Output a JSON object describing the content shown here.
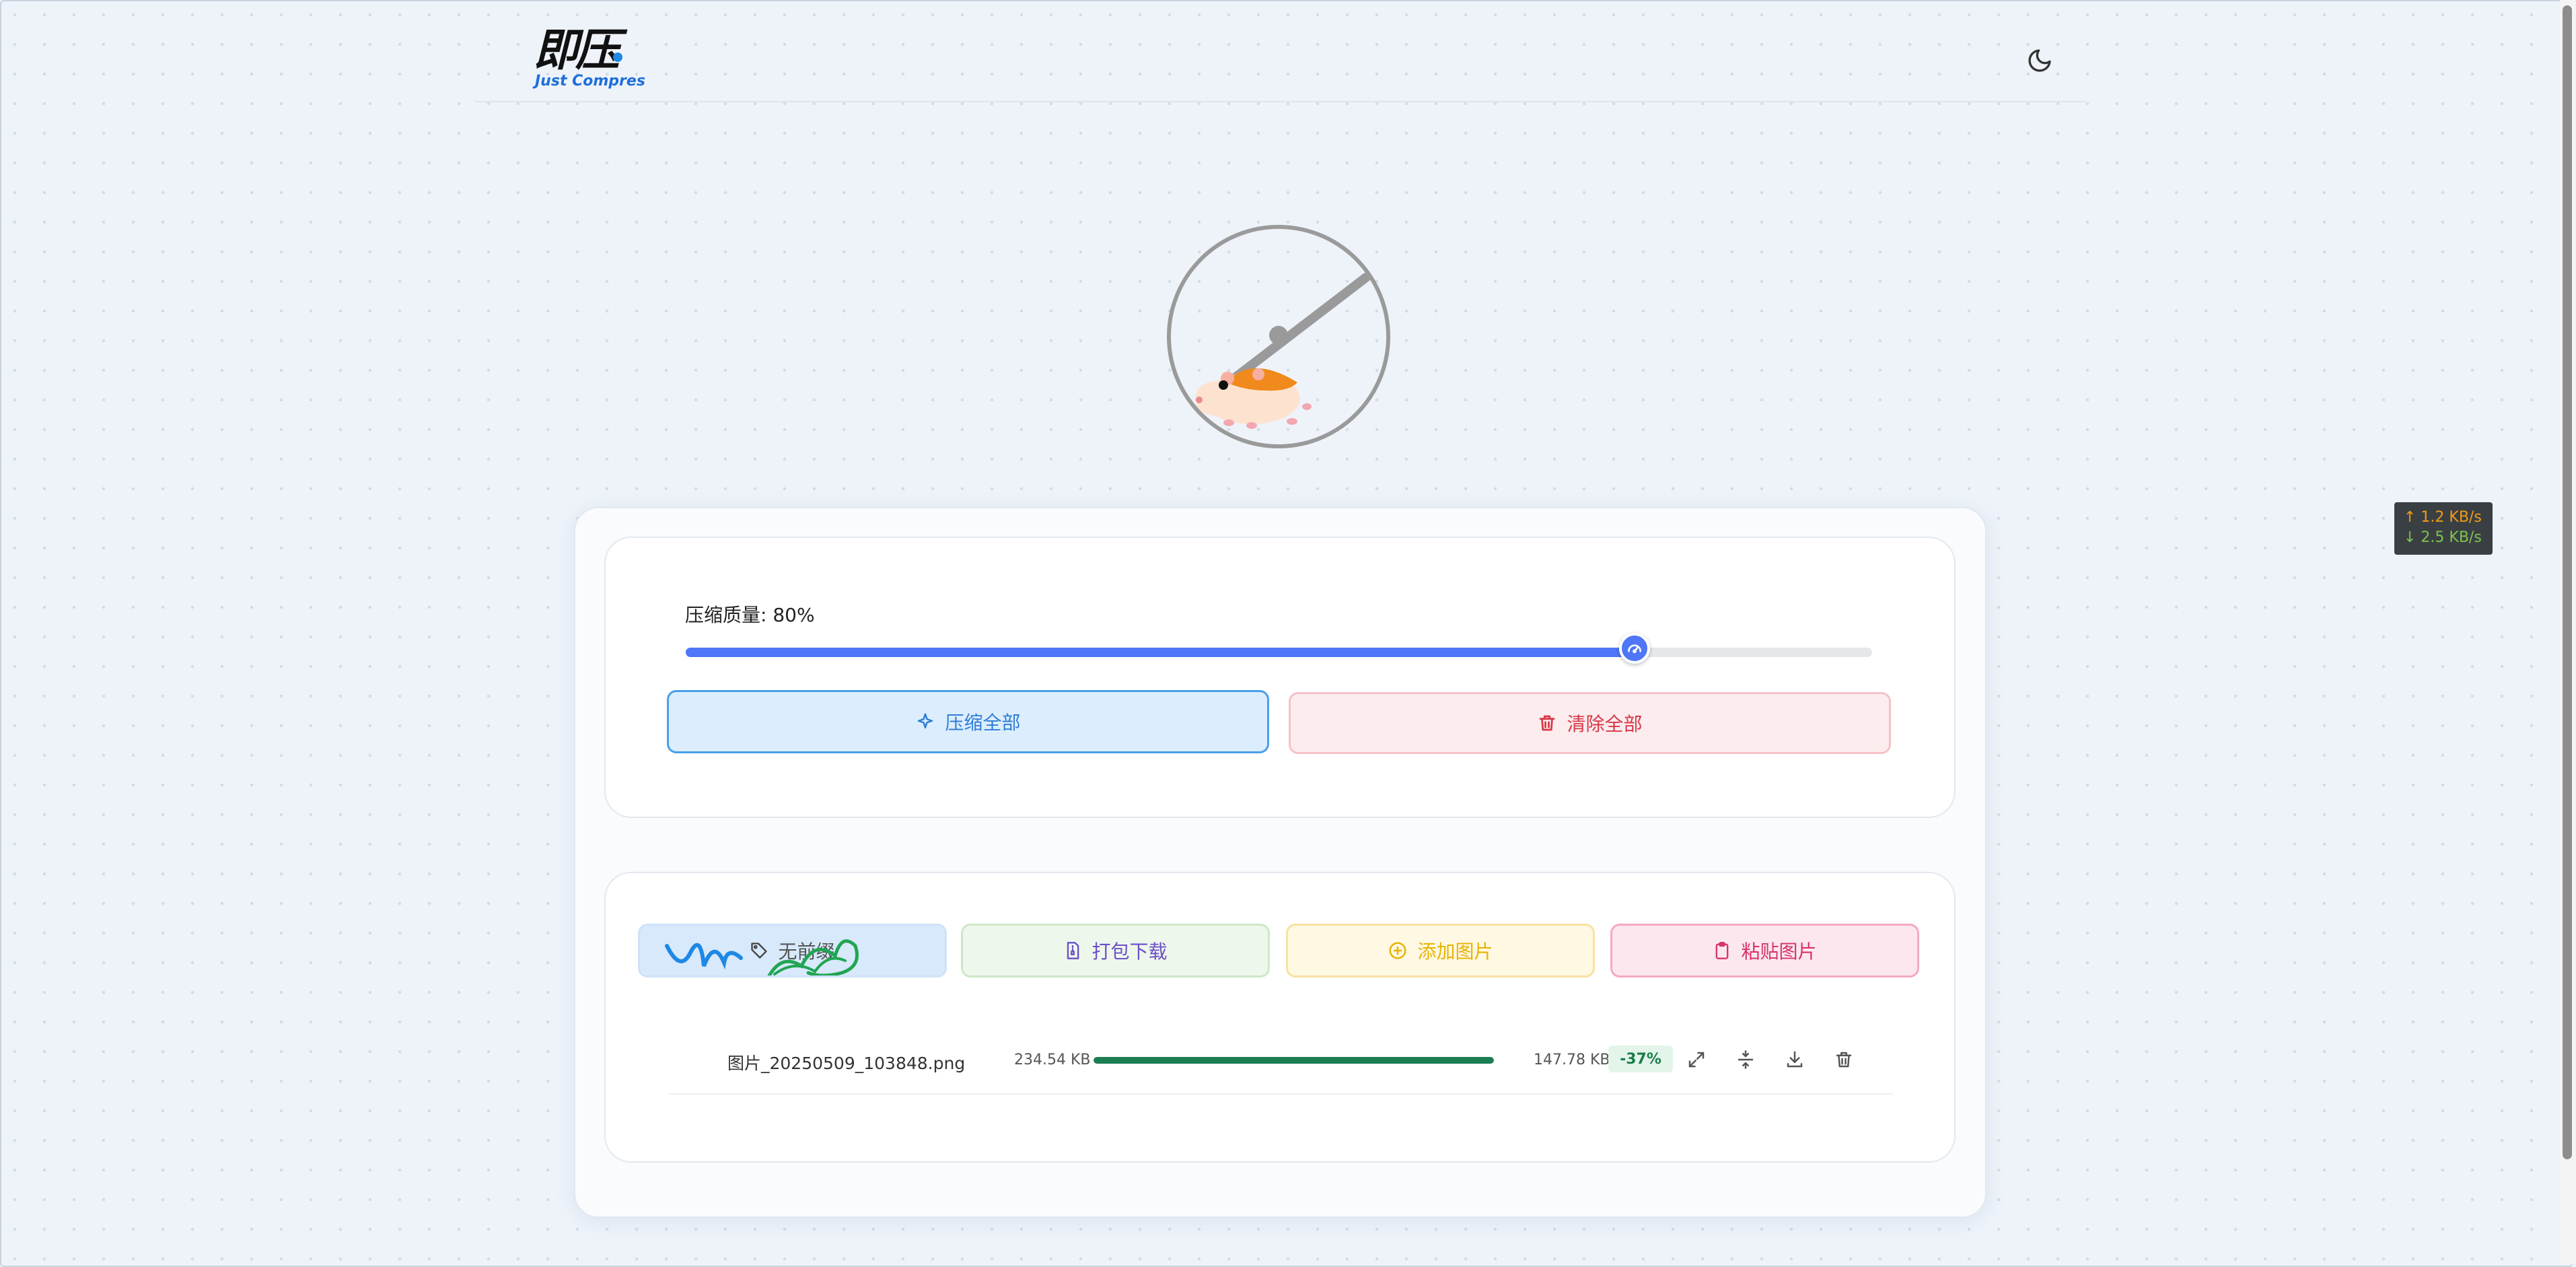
{
  "header": {
    "logo_main": "即压",
    "logo_sub": "Just Compres",
    "theme_icon": "moon-icon"
  },
  "network": {
    "upload": "↑ 1.2 KB/s",
    "download": "↓ 2.5 KB/s"
  },
  "settings": {
    "quality_label": "压缩质量: 80%",
    "quality_value": 0.8,
    "compress_all": "压缩全部",
    "clear_all": "清除全部"
  },
  "toolbar": {
    "tag_label": "无前缀",
    "zip_download": "打包下载",
    "add_image": "添加图片",
    "paste_image": "粘贴图片"
  },
  "files": [
    {
      "name": "图片_20250509_103848.png",
      "original_size": "234.54 KB",
      "progress": 1.0,
      "compressed_size": "147.78 KB",
      "ratio": "-37%"
    }
  ],
  "colors": {
    "accent": "#4f76f6",
    "success": "#1c7d53",
    "danger": "#d63846"
  }
}
